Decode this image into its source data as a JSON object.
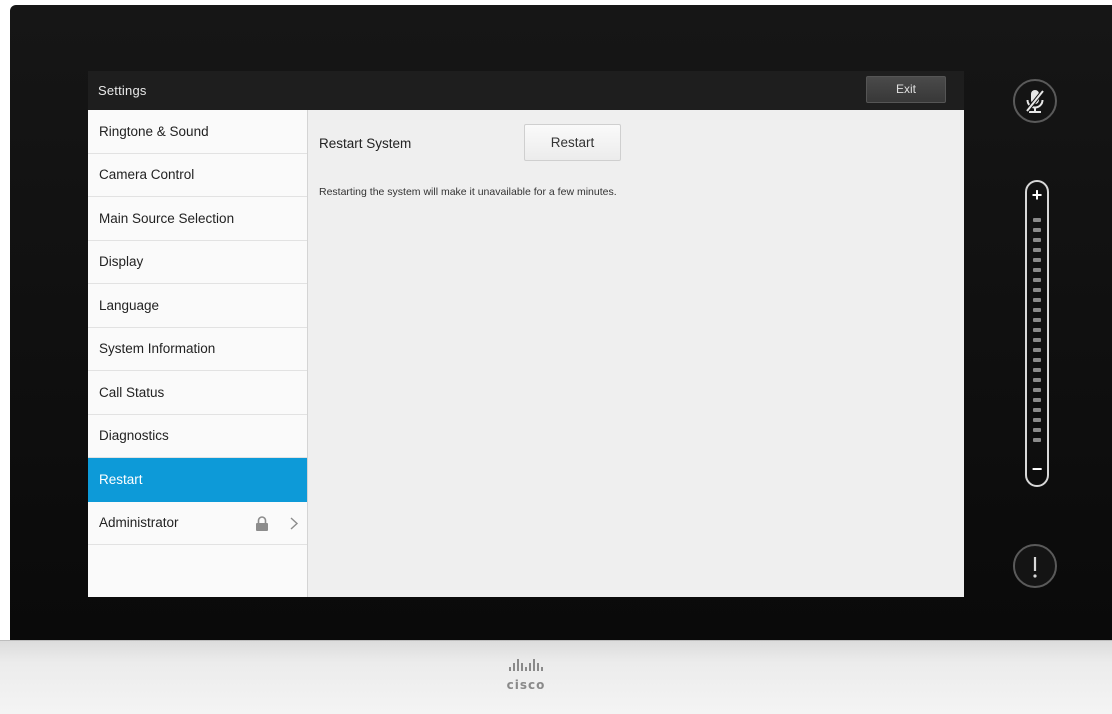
{
  "window": {
    "title": "Settings",
    "exit_label": "Exit"
  },
  "sidebar": {
    "items": [
      {
        "label": "Ringtone & Sound"
      },
      {
        "label": "Camera Control"
      },
      {
        "label": "Main Source Selection"
      },
      {
        "label": "Display"
      },
      {
        "label": "Language"
      },
      {
        "label": "System Information"
      },
      {
        "label": "Call Status"
      },
      {
        "label": "Diagnostics"
      },
      {
        "label": "Restart",
        "active": true
      },
      {
        "label": "Administrator",
        "icons": [
          "lock-icon",
          "chevron-right-icon"
        ]
      }
    ]
  },
  "content": {
    "restart_label": "Restart System",
    "restart_button": "Restart",
    "description": "Restarting the system will make it unavailable for a few minutes."
  },
  "controls": {
    "mic_icon": "mic-muted-icon",
    "volume_plus": "+",
    "volume_minus": "−",
    "alert_icon": "exclamation-icon"
  },
  "brand": {
    "logo_text": "cisco"
  },
  "colors": {
    "accent": "#0d9ad8",
    "titlebar": "#1e1e1e",
    "frame": "#111111"
  }
}
